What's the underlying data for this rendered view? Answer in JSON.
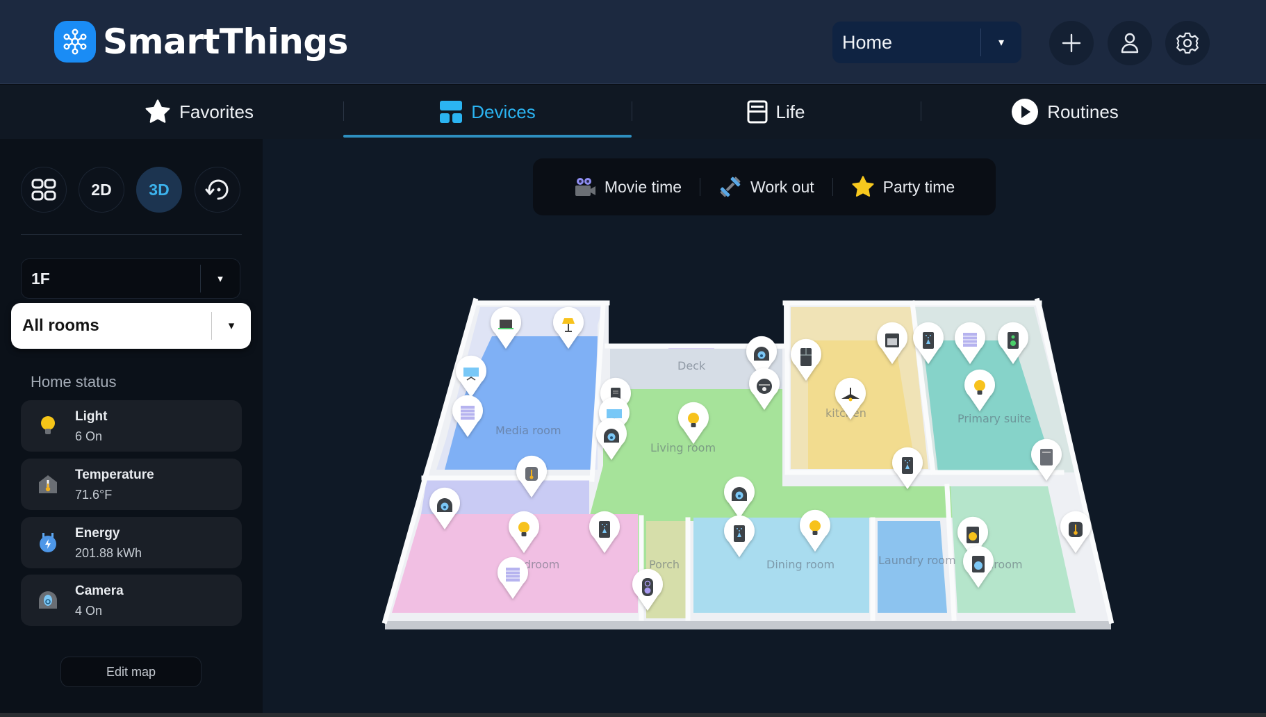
{
  "app": {
    "name": "SmartThings",
    "logo_icon": "smartthings-hub-icon",
    "brand_color": "#1a8cf5"
  },
  "header": {
    "location_select": {
      "value": "Home",
      "caret": "▾"
    },
    "buttons": [
      {
        "name": "add",
        "icon": "plus-icon"
      },
      {
        "name": "account",
        "icon": "person-icon"
      },
      {
        "name": "settings",
        "icon": "gear-icon"
      }
    ]
  },
  "tabs": [
    {
      "label": "Favorites",
      "icon": "star-icon",
      "active": false
    },
    {
      "label": "Devices",
      "icon": "devices-grid-icon",
      "active": true
    },
    {
      "label": "Life",
      "icon": "life-book-icon",
      "active": false
    },
    {
      "label": "Routines",
      "icon": "play-circle-icon",
      "active": false
    }
  ],
  "accent_color": "#2bb4f2",
  "sidebar": {
    "view_buttons": [
      {
        "label": "",
        "icon": "grid-view-icon",
        "active": false
      },
      {
        "label": "2D",
        "active": false
      },
      {
        "label": "3D",
        "active": true
      },
      {
        "label": "",
        "icon": "rotate-view-icon",
        "active": false
      }
    ],
    "floor_select": {
      "value": "1F",
      "caret": "▾"
    },
    "room_select": {
      "value": "All rooms",
      "caret": "▾"
    },
    "home_status_title": "Home status",
    "status_cards": [
      {
        "name": "Light",
        "value": "6 On",
        "icon": "light-bulb-icon"
      },
      {
        "name": "Temperature",
        "value": "71.6°F",
        "icon": "thermometer-icon"
      },
      {
        "name": "Energy",
        "value": "201.88 kWh",
        "icon": "energy-plug-icon"
      },
      {
        "name": "Camera",
        "value": "4 On",
        "icon": "camera-icon"
      }
    ],
    "edit_map_label": "Edit map"
  },
  "scenes": [
    {
      "label": "Movie time",
      "icon": "movie-camera-icon"
    },
    {
      "label": "Work out",
      "icon": "dumbbell-icon"
    },
    {
      "label": "Party time",
      "icon": "star-party-icon"
    }
  ],
  "floorplan": {
    "rooms": [
      {
        "name": "Media room",
        "color": "#7fb0f5"
      },
      {
        "name": "Deck",
        "color": "#b7a6ee"
      },
      {
        "name": "Living room",
        "color": "#a6e39a"
      },
      {
        "name": "kitchen",
        "color": "#f2dc8f"
      },
      {
        "name": "Primary suite",
        "color": "#86d3c9"
      },
      {
        "name": "Bedroom",
        "color": "#f1bfe3"
      },
      {
        "name": "Porch",
        "color": "#d6deaa"
      },
      {
        "name": "Dining room",
        "color": "#a9dcef"
      },
      {
        "name": "Laundry room",
        "color": "#8cc3ef"
      },
      {
        "name": "Bathroom",
        "color": "#b5e5cb"
      }
    ],
    "devices": [
      {
        "room": "Media room",
        "type": "laptop"
      },
      {
        "room": "Media room",
        "type": "floor-lamp"
      },
      {
        "room": "Media room",
        "type": "tv"
      },
      {
        "room": "Media room",
        "type": "blind"
      },
      {
        "room": "Media room",
        "type": "thermostat"
      },
      {
        "room": "Living room",
        "type": "air-purifier"
      },
      {
        "room": "Living room",
        "type": "tv"
      },
      {
        "room": "Living room",
        "type": "camera"
      },
      {
        "room": "Living room",
        "type": "light"
      },
      {
        "room": "Deck",
        "type": "camera"
      },
      {
        "room": "Living room",
        "type": "robot-vacuum"
      },
      {
        "room": "kitchen",
        "type": "refrigerator"
      },
      {
        "room": "kitchen",
        "type": "oven"
      },
      {
        "room": "kitchen",
        "type": "pendant-light"
      },
      {
        "room": "kitchen",
        "type": "sensor"
      },
      {
        "room": "Primary suite",
        "type": "sensor"
      },
      {
        "room": "Primary suite",
        "type": "blind"
      },
      {
        "room": "Primary suite",
        "type": "speaker"
      },
      {
        "room": "Primary suite",
        "type": "light"
      },
      {
        "room": "Primary suite",
        "type": "air-conditioner"
      },
      {
        "room": "Bedroom",
        "type": "camera"
      },
      {
        "room": "Bedroom",
        "type": "light"
      },
      {
        "room": "Bedroom",
        "type": "sensor"
      },
      {
        "room": "Bedroom",
        "type": "blind"
      },
      {
        "room": "Porch",
        "type": "doorbell"
      },
      {
        "room": "Dining room",
        "type": "camera"
      },
      {
        "room": "Dining room",
        "type": "sensor"
      },
      {
        "room": "Dining room",
        "type": "light"
      },
      {
        "room": "Laundry room",
        "type": "dryer"
      },
      {
        "room": "Laundry room",
        "type": "washer"
      },
      {
        "room": "Bathroom",
        "type": "thermometer"
      }
    ]
  }
}
